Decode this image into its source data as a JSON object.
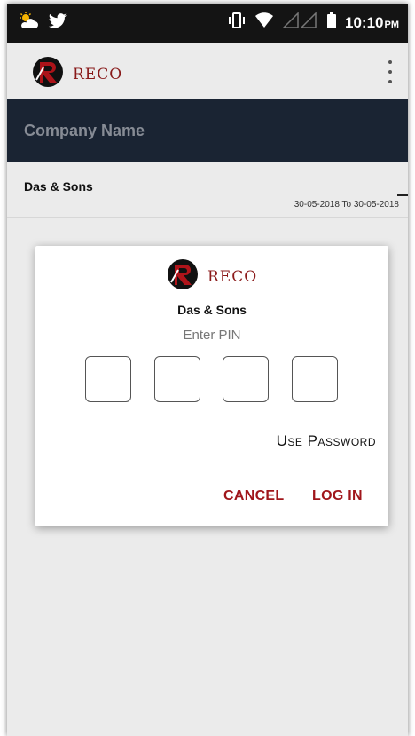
{
  "status_bar": {
    "time": "10:10",
    "ampm": "PM",
    "icons": [
      "weather-icon",
      "twitter-icon",
      "vibrate-icon",
      "wifi-icon",
      "signal-icon",
      "battery-icon"
    ]
  },
  "app_bar": {
    "logo_text": "RECO",
    "menu_icon": "overflow-menu-icon"
  },
  "list_header": {
    "title": "Company Name"
  },
  "companies": [
    {
      "name": "Das & Sons",
      "date_range": "30-05-2018 To 30-05-2018"
    }
  ],
  "dialog": {
    "logo_text": "RECO",
    "company": "Das & Sons",
    "pin_label": "Enter PIN",
    "pin_digits": [
      "",
      "",
      "",
      ""
    ],
    "use_password": "Use Password",
    "cancel": "CANCEL",
    "login": "LOG IN"
  },
  "colors": {
    "accent": "#a0161b",
    "header_band": "#1b2535",
    "status_bar": "#141414",
    "background": "#f0f0f0"
  }
}
